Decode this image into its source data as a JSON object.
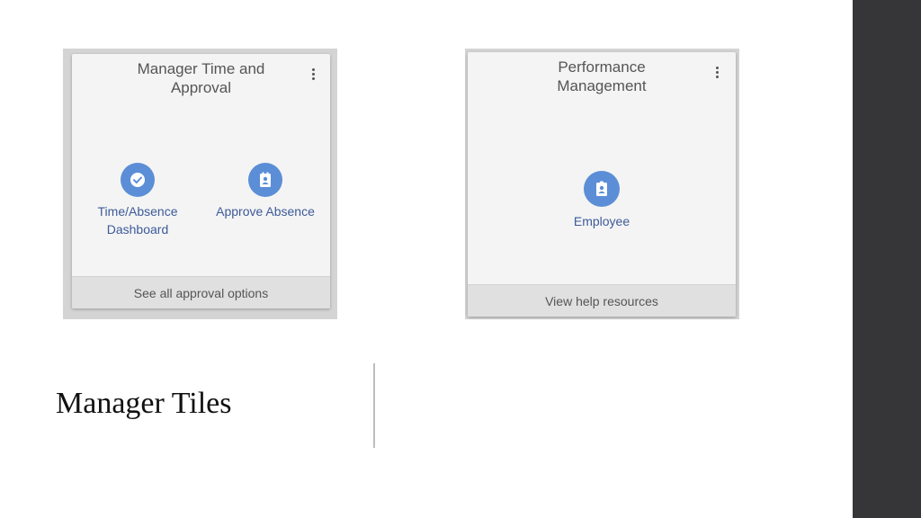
{
  "slide": {
    "title": "Manager Tiles"
  },
  "tiles": [
    {
      "title_line1": "Manager Time and",
      "title_line2": "Approval",
      "actions": [
        {
          "line1": "Time/Absence",
          "line2": "Dashboard",
          "icon": "check-circle-icon"
        },
        {
          "line1": "Approve Absence",
          "line2": "",
          "icon": "badge-calendar-icon"
        }
      ],
      "footer": "See all approval options"
    },
    {
      "title_line1": "Performance",
      "title_line2": "Management",
      "actions": [
        {
          "line1": "Employee",
          "line2": "",
          "icon": "employee-badge-icon"
        }
      ],
      "footer": "View help resources"
    }
  ],
  "colors": {
    "icon_circle": "#5b8ed6",
    "action_text": "#3d5a99",
    "side_band": "#363638"
  }
}
